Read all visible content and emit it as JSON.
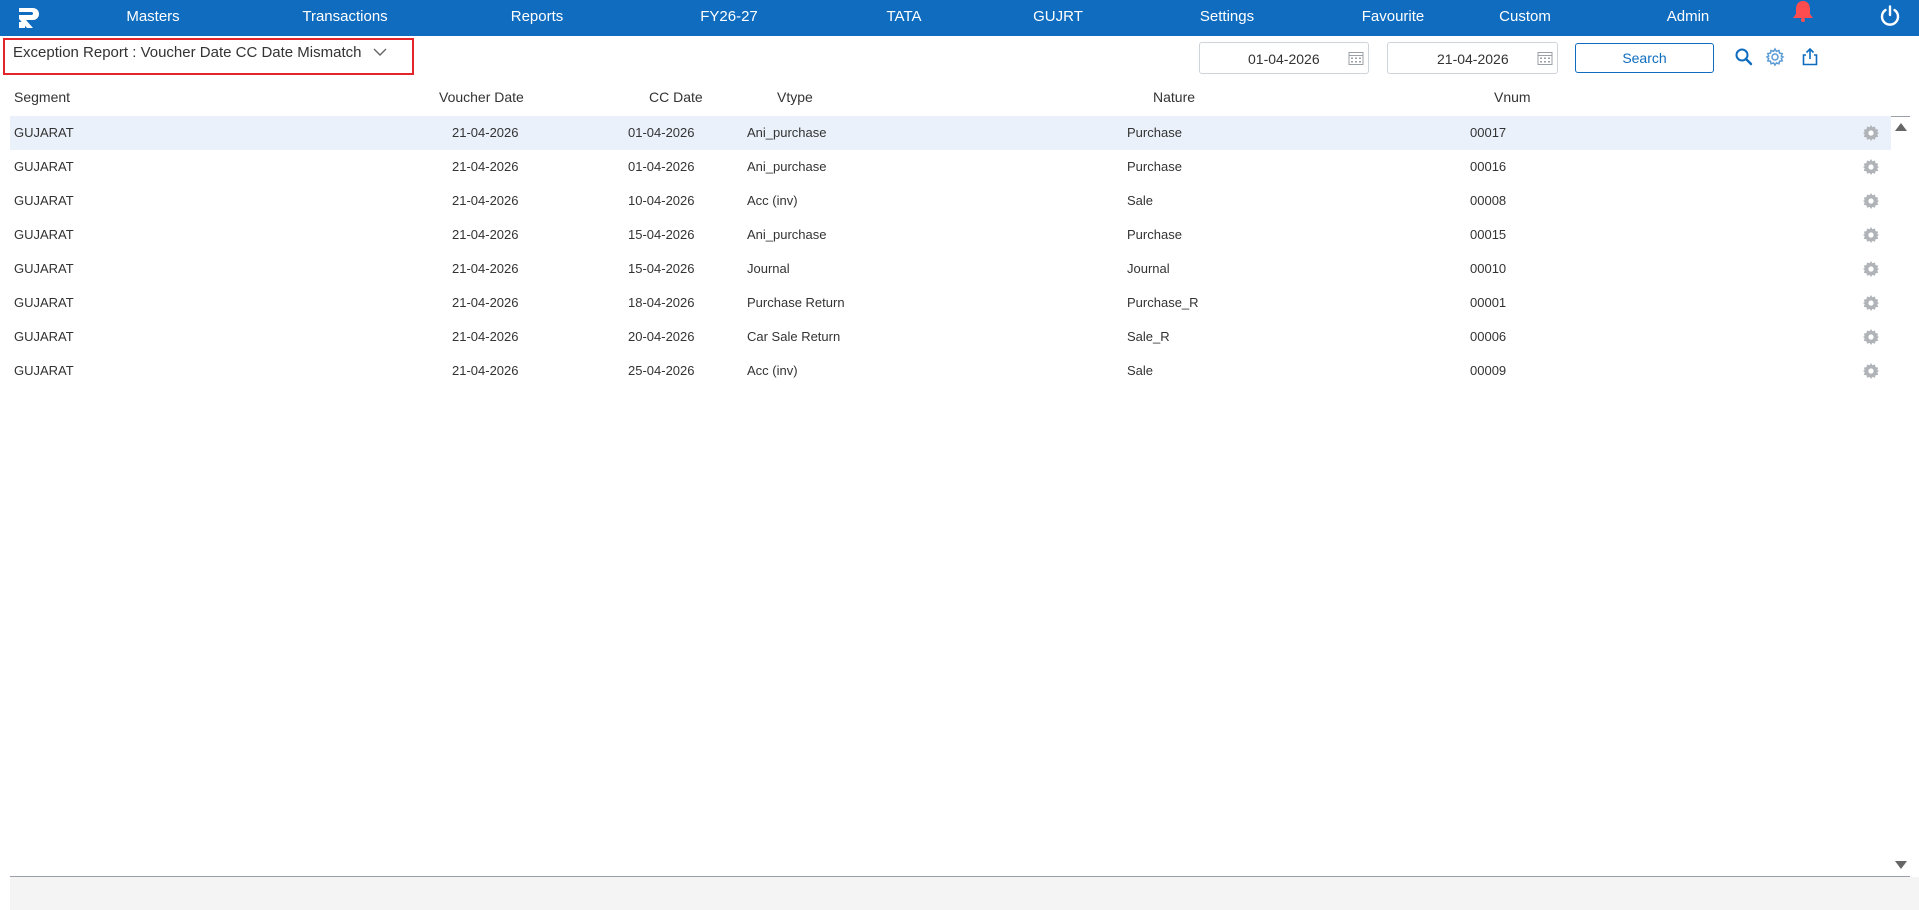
{
  "nav": {
    "items": [
      {
        "label": "Masters"
      },
      {
        "label": "Transactions"
      },
      {
        "label": "Reports"
      },
      {
        "label": "FY26-27"
      },
      {
        "label": "TATA"
      },
      {
        "label": "GUJRT"
      },
      {
        "label": "Settings"
      },
      {
        "label": "Favourite"
      },
      {
        "label": "Custom"
      },
      {
        "label": "Admin"
      }
    ],
    "icons": [
      "app-logo",
      "bell-icon",
      "power-icon"
    ],
    "bar_color": "#0f6cbf",
    "bell_color": "#ff4d4f"
  },
  "toolbar": {
    "report_title": "Exception Report : Voucher Date CC Date Mismatch",
    "from_date": "01-04-2026",
    "to_date": "21-04-2026",
    "search_label": "Search",
    "highlight_color": "#e3242b"
  },
  "table": {
    "columns": [
      "Segment",
      "Voucher Date",
      "CC Date",
      "Vtype",
      "Nature",
      "Vnum"
    ],
    "rows": [
      {
        "segment": "GUJARAT",
        "voucher_date": "21-04-2026",
        "cc_date": "01-04-2026",
        "vtype": "Ani_purchase",
        "nature": "Purchase",
        "vnum": "00017"
      },
      {
        "segment": "GUJARAT",
        "voucher_date": "21-04-2026",
        "cc_date": "01-04-2026",
        "vtype": "Ani_purchase",
        "nature": "Purchase",
        "vnum": "00016"
      },
      {
        "segment": "GUJARAT",
        "voucher_date": "21-04-2026",
        "cc_date": "10-04-2026",
        "vtype": "Acc (inv)",
        "nature": "Sale",
        "vnum": "00008"
      },
      {
        "segment": "GUJARAT",
        "voucher_date": "21-04-2026",
        "cc_date": "15-04-2026",
        "vtype": "Ani_purchase",
        "nature": "Purchase",
        "vnum": "00015"
      },
      {
        "segment": "GUJARAT",
        "voucher_date": "21-04-2026",
        "cc_date": "15-04-2026",
        "vtype": "Journal",
        "nature": "Journal",
        "vnum": "00010"
      },
      {
        "segment": "GUJARAT",
        "voucher_date": "21-04-2026",
        "cc_date": "18-04-2026",
        "vtype": "Purchase Return",
        "nature": "Purchase_R",
        "vnum": "00001"
      },
      {
        "segment": "GUJARAT",
        "voucher_date": "21-04-2026",
        "cc_date": "20-04-2026",
        "vtype": "Car Sale Return",
        "nature": "Sale_R",
        "vnum": "00006"
      },
      {
        "segment": "GUJARAT",
        "voucher_date": "21-04-2026",
        "cc_date": "25-04-2026",
        "vtype": "Acc (inv)",
        "nature": "Sale",
        "vnum": "00009"
      }
    ]
  }
}
